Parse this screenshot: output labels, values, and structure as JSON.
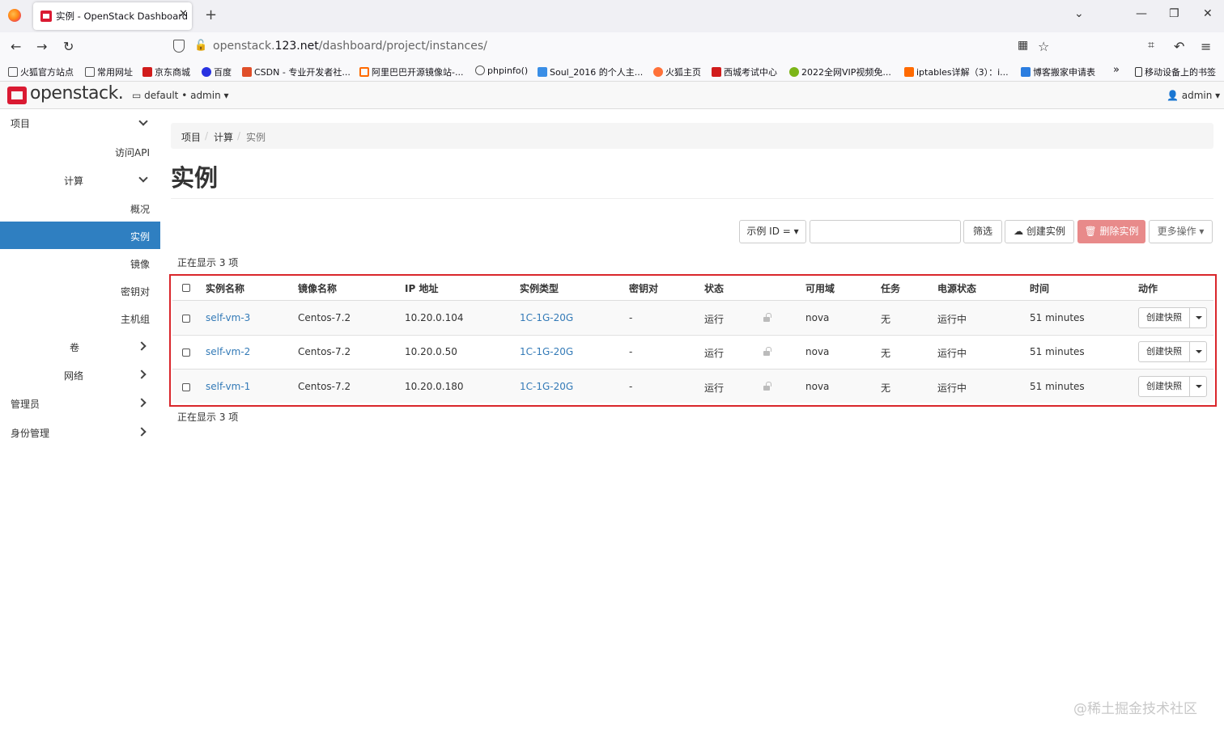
{
  "browser": {
    "tab_title": "实例 - OpenStack Dashboard",
    "tab_close": "✕",
    "new_tab": "+",
    "url_domain_prefix": "openstack.",
    "url_domain_main": "123.net",
    "url_path": "/dashboard/project/instances/",
    "bookmarks": [
      {
        "label": "火狐官方站点",
        "icon_color": "#555"
      },
      {
        "label": "常用网址",
        "icon_color": "#555"
      },
      {
        "label": "京东商城",
        "icon_color": "#d11c1c"
      },
      {
        "label": "百度",
        "icon_color": "#2932e1"
      },
      {
        "label": "CSDN - 专业开发者社...",
        "icon_color": "#e04f2a"
      },
      {
        "label": "阿里巴巴开源镜像站-...",
        "icon_color": "#ff6a00"
      },
      {
        "label": "phpinfo()",
        "icon_color": "#555"
      },
      {
        "label": "Soul_2016 的个人主...",
        "icon_color": "#3a8ee6"
      },
      {
        "label": "火狐主页",
        "icon_color": "#ff7139"
      },
      {
        "label": "西城考试中心",
        "icon_color": "#d11c1c"
      },
      {
        "label": "2022全网VIP视频免...",
        "icon_color": "#7cb518"
      },
      {
        "label": "iptables详解（3）：i...",
        "icon_color": "#ff6a00"
      },
      {
        "label": "博客搬家申请表",
        "icon_color": "#2b7de0"
      }
    ],
    "bookmarks_more": "»",
    "mobile_bookmarks": "移动设备上的书签"
  },
  "header": {
    "logo_text": "openstack.",
    "project_selector": "default • admin ▾",
    "user_menu": "👤 admin ▾"
  },
  "sidebar": {
    "project": "项目",
    "api_access": "访问API",
    "compute": "计算",
    "overview": "概况",
    "instances": "实例",
    "images": "镜像",
    "key_pairs": "密钥对",
    "host_groups": "主机组",
    "volumes": "卷",
    "network": "网络",
    "admin": "管理员",
    "identity": "身份管理"
  },
  "breadcrumb": [
    "项目",
    "计算",
    "实例"
  ],
  "page_title": "实例",
  "toolbar": {
    "filter_field": "示例 ID = ▾",
    "filter_button": "筛选",
    "create_button": "创建实例",
    "delete_button": "删除实例",
    "more_button": "更多操作 ▾"
  },
  "count_text": "正在显示 3 项",
  "table": {
    "headers": [
      "实例名称",
      "镜像名称",
      "IP 地址",
      "实例类型",
      "密钥对",
      "状态",
      "可用域",
      "任务",
      "电源状态",
      "时间",
      "动作"
    ],
    "rows": [
      {
        "name": "self-vm-3",
        "image": "Centos-7.2",
        "ip": "10.20.0.104",
        "flavor": "1C-1G-20G",
        "keypair": "-",
        "status": "运行",
        "zone": "nova",
        "task": "无",
        "power": "运行中",
        "time": "51 minutes",
        "action": "创建快照"
      },
      {
        "name": "self-vm-2",
        "image": "Centos-7.2",
        "ip": "10.20.0.50",
        "flavor": "1C-1G-20G",
        "keypair": "-",
        "status": "运行",
        "zone": "nova",
        "task": "无",
        "power": "运行中",
        "time": "51 minutes",
        "action": "创建快照"
      },
      {
        "name": "self-vm-1",
        "image": "Centos-7.2",
        "ip": "10.20.0.180",
        "flavor": "1C-1G-20G",
        "keypair": "-",
        "status": "运行",
        "zone": "nova",
        "task": "无",
        "power": "运行中",
        "time": "51 minutes",
        "action": "创建快照"
      }
    ]
  },
  "watermark": "@稀土掘金技术社区",
  "colors": {
    "accent": "#2f7fc1",
    "danger": "#e88a8a",
    "highlight_border": "#d9262b",
    "link": "#337ab7"
  }
}
